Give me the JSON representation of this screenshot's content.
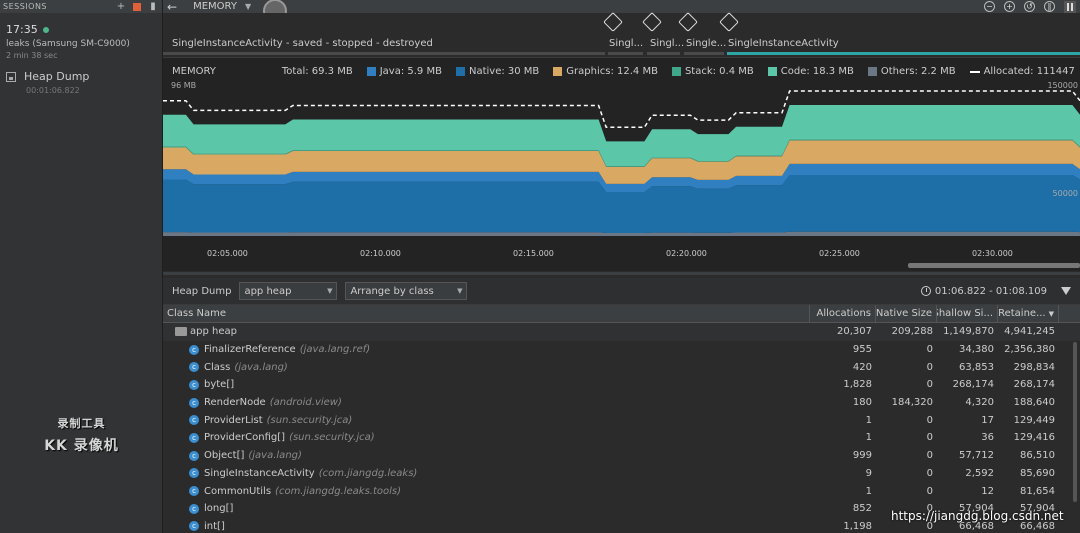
{
  "sessions": {
    "panel_title": "SESSIONS",
    "add_icon": "plus-icon",
    "stop_icon": "stop-icon",
    "layout_icon": "panel-toggle-icon",
    "session": {
      "time": "17:35",
      "device": "leaks (Samsung SM-C9000)",
      "duration": "2 min 38 sec"
    },
    "artifact": {
      "label": "Heap Dump",
      "time": "00:01:06.822"
    },
    "watermark": {
      "line1": "录制工具",
      "line2": "KK 录像机"
    }
  },
  "toolbar": {
    "back_icon": "back-arrow-icon",
    "profiler": "MEMORY",
    "controls": [
      "zoom-out-icon",
      "zoom-in-icon",
      "reset-zoom-icon",
      "attach-icon"
    ],
    "pause_icon": "pause-icon"
  },
  "events": {
    "lifecycle_label": "SingleInstanceActivity - saved - stopped - destroyed",
    "activities": [
      {
        "name": "Singl..."
      },
      {
        "name": "Singl..."
      },
      {
        "name": "Single..."
      },
      {
        "name": "SingleInstanceActivity"
      }
    ]
  },
  "chart": {
    "title": "MEMORY",
    "total": "Total: 69.3 MB",
    "legend": [
      {
        "label": "Java: 5.9 MB",
        "color": "#2f7fc1"
      },
      {
        "label": "Native: 30 MB",
        "color": "#1e6fa8"
      },
      {
        "label": "Graphics: 12.4 MB",
        "color": "#d9a862"
      },
      {
        "label": "Stack: 0.4 MB",
        "color": "#3fa88a"
      },
      {
        "label": "Code: 18.3 MB",
        "color": "#5cc6a8"
      },
      {
        "label": "Others: 2.2 MB",
        "color": "#6c7785"
      },
      {
        "label": "Allocated: 111447",
        "color": "#ffffff"
      }
    ],
    "y_left_top": "96 MB",
    "y_right_top": "150000",
    "y_right_mid": "50000",
    "x_ticks": [
      "02:05.000",
      "02:10.000",
      "02:15.000",
      "02:20.000",
      "02:25.000",
      "02:30.000"
    ]
  },
  "chart_data": {
    "type": "area",
    "title": "MEMORY",
    "x": [
      "02:05.000",
      "02:10.000",
      "02:15.000",
      "02:20.000",
      "02:25.000",
      "02:30.000"
    ],
    "series": [
      {
        "name": "Java",
        "values": [
          5.9,
          5.9,
          5.9,
          5.9,
          5.9,
          5.9
        ]
      },
      {
        "name": "Native",
        "values": [
          30,
          30,
          30,
          30,
          30,
          30
        ]
      },
      {
        "name": "Graphics",
        "values": [
          12.4,
          12.4,
          12.4,
          12.4,
          12.4,
          12.4
        ]
      },
      {
        "name": "Stack",
        "values": [
          0.4,
          0.4,
          0.4,
          0.4,
          0.4,
          0.4
        ]
      },
      {
        "name": "Code",
        "values": [
          18.3,
          18.3,
          18.3,
          18.3,
          18.3,
          18.3
        ]
      },
      {
        "name": "Others",
        "values": [
          2.2,
          2.2,
          2.2,
          2.2,
          2.2,
          2.2
        ]
      }
    ],
    "ylabel": "",
    "ylim": [
      0,
      96
    ]
  },
  "heap": {
    "label": "Heap Dump",
    "heap_select": "app heap",
    "arrange_select": "Arrange by class",
    "range": "01:06.822 - 01:08.109",
    "columns": [
      "Class Name",
      "Allocations",
      "Native Size",
      "Shallow Si...",
      "Retaine..."
    ],
    "root": {
      "name": "app heap",
      "alloc": "20,307",
      "native": "209,288",
      "shallow": "1,149,870",
      "retained": "4,941,245"
    },
    "rows": [
      {
        "name": "FinalizerReference",
        "pkg": "(java.lang.ref)",
        "alloc": "955",
        "native": "0",
        "shallow": "34,380",
        "retained": "2,356,380"
      },
      {
        "name": "Class",
        "pkg": "(java.lang)",
        "alloc": "420",
        "native": "0",
        "shallow": "63,853",
        "retained": "298,834"
      },
      {
        "name": "byte[]",
        "pkg": "",
        "alloc": "1,828",
        "native": "0",
        "shallow": "268,174",
        "retained": "268,174"
      },
      {
        "name": "RenderNode",
        "pkg": "(android.view)",
        "alloc": "180",
        "native": "184,320",
        "shallow": "4,320",
        "retained": "188,640"
      },
      {
        "name": "ProviderList",
        "pkg": "(sun.security.jca)",
        "alloc": "1",
        "native": "0",
        "shallow": "17",
        "retained": "129,449"
      },
      {
        "name": "ProviderConfig[]",
        "pkg": "(sun.security.jca)",
        "alloc": "1",
        "native": "0",
        "shallow": "36",
        "retained": "129,416"
      },
      {
        "name": "Object[]",
        "pkg": "(java.lang)",
        "alloc": "999",
        "native": "0",
        "shallow": "57,712",
        "retained": "86,510"
      },
      {
        "name": "SingleInstanceActivity",
        "pkg": "(com.jiangdg.leaks)",
        "alloc": "9",
        "native": "0",
        "shallow": "2,592",
        "retained": "85,690"
      },
      {
        "name": "CommonUtils",
        "pkg": "(com.jiangdg.leaks.tools)",
        "alloc": "1",
        "native": "0",
        "shallow": "12",
        "retained": "81,654"
      },
      {
        "name": "long[]",
        "pkg": "",
        "alloc": "852",
        "native": "0",
        "shallow": "57,904",
        "retained": "57,904"
      },
      {
        "name": "int[]",
        "pkg": "",
        "alloc": "1,198",
        "native": "0",
        "shallow": "66,468",
        "retained": "66,468"
      }
    ],
    "credit": "https://jiangdg.blog.csdn.net"
  }
}
